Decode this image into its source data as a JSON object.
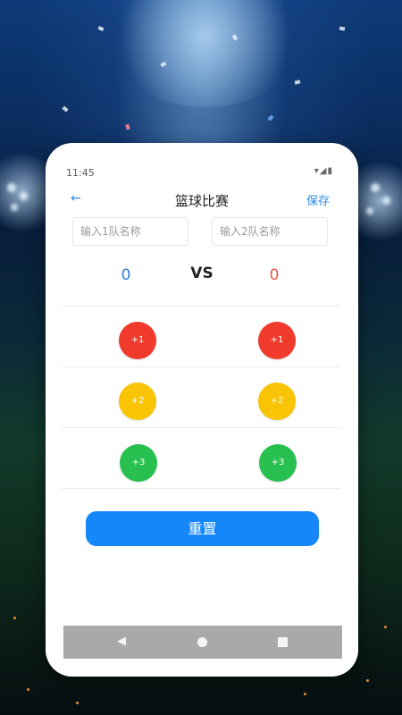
{
  "status_bar": {
    "time": "11:45",
    "icons": "▾◢▮"
  },
  "app_bar": {
    "back_icon": "←",
    "title": "篮球比赛",
    "save_label": "保存"
  },
  "team_inputs": {
    "team1_placeholder": "输入1队名称",
    "team2_placeholder": "输入2队名称"
  },
  "scoreboard": {
    "team1_score": "0",
    "vs_label": "VS",
    "team2_score": "0"
  },
  "score_buttons": {
    "plus1": "+1",
    "plus2": "+2",
    "plus3": "+3"
  },
  "colors": {
    "plus1": "#ef3a2c",
    "plus2": "#f8c404",
    "plus3": "#28c04e",
    "accent": "#1687f8"
  },
  "reset_label": "重置",
  "nav_bar": {
    "icons": [
      "back-triangle",
      "home-circle",
      "recent-square"
    ]
  }
}
